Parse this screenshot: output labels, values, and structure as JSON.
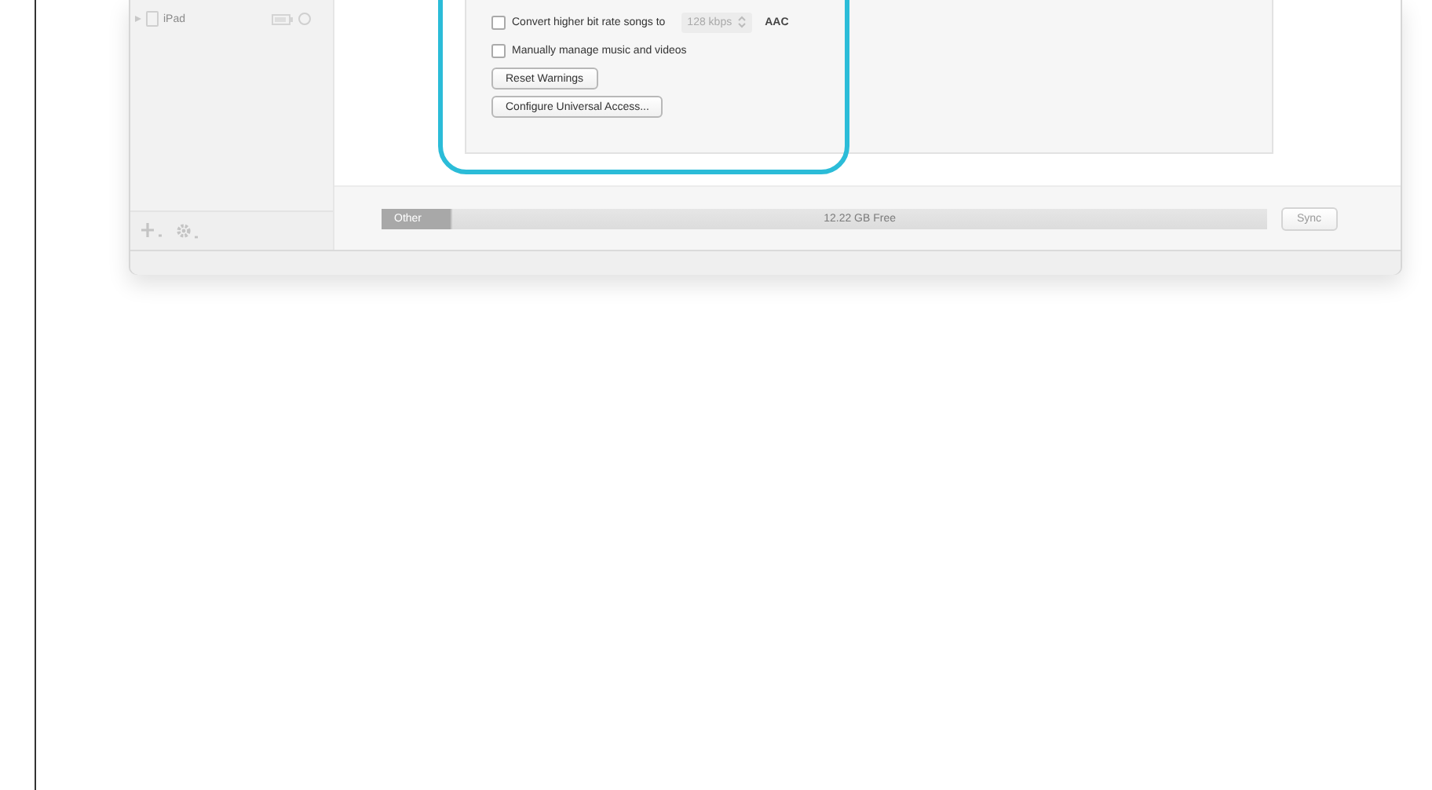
{
  "sidebar": {
    "devices": [
      {
        "name": "iPad",
        "expanded": false
      }
    ]
  },
  "options": [
    {
      "kind": "checkbox",
      "label": "Convert higher bit rate songs to",
      "checked": false,
      "select": "128 kbps",
      "suffix": "AAC"
    },
    {
      "kind": "checkbox",
      "label": "Manually manage music and videos",
      "checked": false
    },
    {
      "kind": "button",
      "label": "Reset Warnings"
    },
    {
      "kind": "button",
      "label": "Configure Universal Access..."
    }
  ],
  "storage": {
    "segments": [
      {
        "label": "Other",
        "level": 0.08
      }
    ],
    "free": "12.22 GB Free"
  },
  "sync_button": "Sync"
}
